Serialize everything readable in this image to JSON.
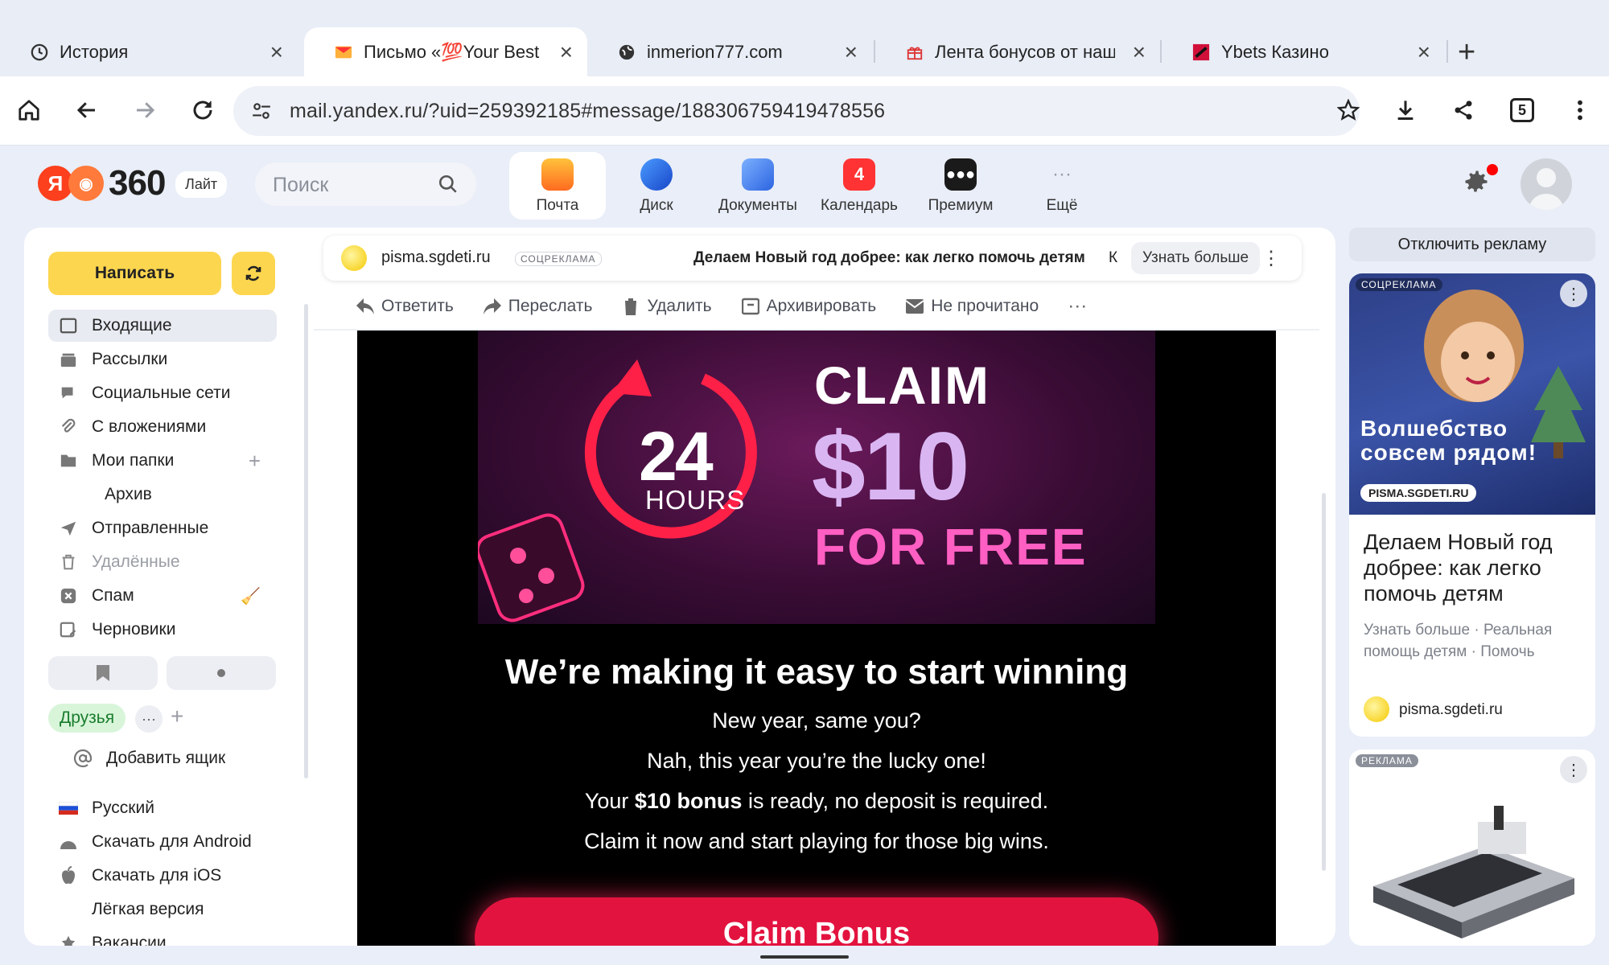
{
  "browser": {
    "tabs": [
      {
        "title": "История",
        "icon": "history-icon"
      },
      {
        "title": "Письмо «💯Your Best Year",
        "icon": "mail-envelope-icon"
      },
      {
        "title": "inmerion777.com",
        "icon": "globe-icon"
      },
      {
        "title": "Лента бонусов от наших п",
        "icon": "gift-icon"
      },
      {
        "title": "Ybets Казино",
        "icon": "ybets-icon"
      }
    ],
    "url": "mail.yandex.ru/?uid=259392185#message/188306759419478556",
    "tab_count": "5"
  },
  "header": {
    "logo_number": "360",
    "logo_ya": "Я",
    "lite_label": "Лайт",
    "search_placeholder": "Поиск",
    "services": [
      {
        "label": "Почта",
        "icon": "mail-service-icon",
        "color": "#ff8a1f"
      },
      {
        "label": "Диск",
        "icon": "disk-service-icon",
        "color": "#2f6fe5"
      },
      {
        "label": "Документы",
        "icon": "documents-service-icon",
        "color": "#3a7bef"
      },
      {
        "label": "Календарь",
        "icon": "calendar-service-icon",
        "color": "#ff3333",
        "badge": "4"
      },
      {
        "label": "Премиум",
        "icon": "premium-service-icon",
        "color": "#1a1a1a"
      },
      {
        "label": "Ещё",
        "icon": "more-dots-icon",
        "color": "#9a9da5"
      }
    ]
  },
  "sidebar": {
    "compose_label": "Написать",
    "folders": [
      {
        "label": "Входящие",
        "icon": "inbox-icon"
      },
      {
        "label": "Рассылки",
        "icon": "newsletters-icon"
      },
      {
        "label": "Социальные сети",
        "icon": "social-icon"
      },
      {
        "label": "С вложениями",
        "icon": "attachment-icon"
      },
      {
        "label": "Мои папки",
        "icon": "folders-icon"
      },
      {
        "label": "Архив",
        "icon": ""
      },
      {
        "label": "Отправленные",
        "icon": "sent-icon"
      },
      {
        "label": "Удалённые",
        "icon": "trash-icon"
      },
      {
        "label": "Спам",
        "icon": "spam-icon"
      },
      {
        "label": "Черновики",
        "icon": "drafts-icon"
      }
    ],
    "friends_label": "Друзья",
    "add_mailbox_label": "Добавить ящик",
    "footer": [
      {
        "label": "Русский",
        "icon": "russian-flag-icon"
      },
      {
        "label": "Скачать для Android",
        "icon": "android-icon"
      },
      {
        "label": "Скачать для iOS",
        "icon": "apple-icon"
      },
      {
        "label": "Лёгкая версия",
        "icon": "light-version-icon"
      },
      {
        "label": "Вакансии",
        "icon": "jobs-icon"
      }
    ]
  },
  "ad_bar": {
    "site": "pisma.sgdeti.ru",
    "tag": "СОЦРЕКЛАМА",
    "text": "Делаем Новый год добрее: как легко помочь детям",
    "truncated": "К",
    "button": "Узнать больше"
  },
  "actions": [
    {
      "label": "Ответить",
      "icon": "reply-icon"
    },
    {
      "label": "Переслать",
      "icon": "forward-icon"
    },
    {
      "label": "Удалить",
      "icon": "delete-icon"
    },
    {
      "label": "Архивировать",
      "icon": "archive-icon"
    },
    {
      "label": "Не прочитано",
      "icon": "unread-icon"
    }
  ],
  "email": {
    "hero": {
      "timer_number": "24",
      "timer_unit": "HOURS",
      "claim": "CLAIM",
      "amount": "$10",
      "free": "FOR FREE"
    },
    "headline": "We’re making it easy to start winning",
    "line1": "New year, same you?",
    "line2": "Nah, this year you’re the lucky one!",
    "line3_pre": "Your ",
    "line3_bold": "$10 bonus",
    "line3_post": " is ready, no deposit is required.",
    "line4": "Claim it now and start playing for those big wins.",
    "cta": "Claim Bonus",
    "accent_color": "#e3133f"
  },
  "right_ads": {
    "disable_label": "Отключить рекламу",
    "card1": {
      "tag": "СОЦРЕКЛАМА",
      "image_text_1": "Волшебство",
      "image_text_2": "совсем рядом!",
      "image_chip": "PISMA.SGDETI.RU",
      "title": "Делаем Новый год добрее: как легко помочь детям",
      "sub": "Узнать больше · Реальная помощь детям · Помочь",
      "site": "pisma.sgdeti.ru"
    },
    "card2": {
      "tag": "РЕКЛАМА"
    }
  }
}
